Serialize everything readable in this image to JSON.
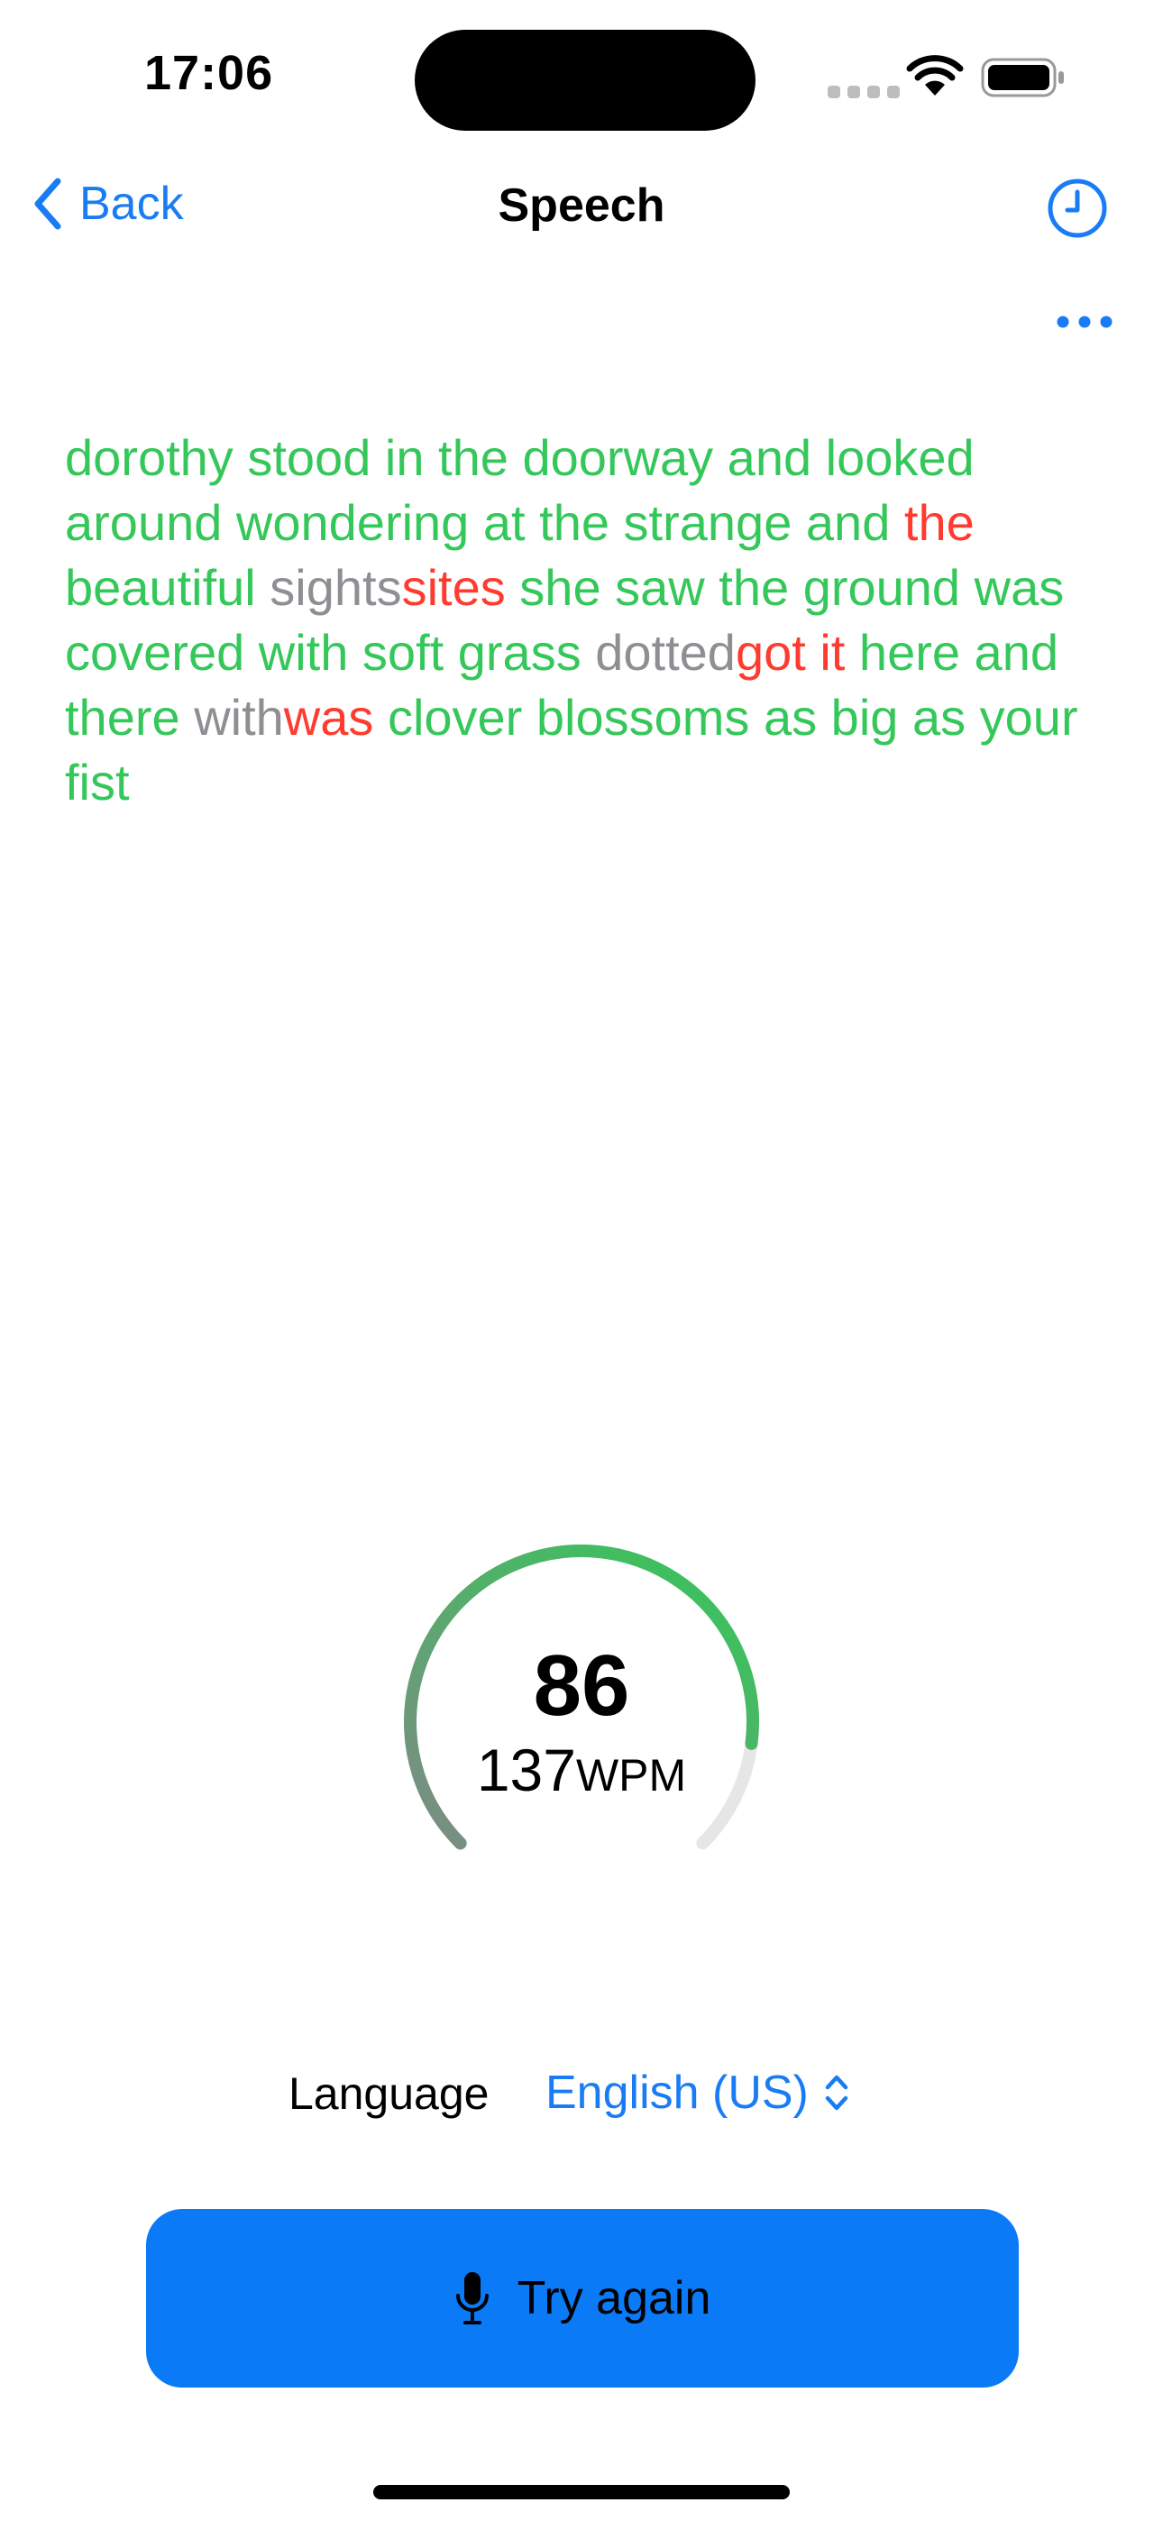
{
  "status_bar": {
    "time": "17:06"
  },
  "nav": {
    "back_label": "Back",
    "title": "Speech"
  },
  "transcript": [
    {
      "text": " dorothy stood in the doorway and looked around wondering at the strange and ",
      "status": "correct"
    },
    {
      "text": "the",
      "status": "wrong"
    },
    {
      "text": " beautiful ",
      "status": "correct"
    },
    {
      "text": "sights",
      "status": "missed"
    },
    {
      "text": "sites",
      "status": "wrong"
    },
    {
      "text": " she saw the ground was covered with soft grass ",
      "status": "correct"
    },
    {
      "text": "dotted",
      "status": "missed"
    },
    {
      "text": "got it",
      "status": "wrong"
    },
    {
      "text": " here and there ",
      "status": "correct"
    },
    {
      "text": "with",
      "status": "missed"
    },
    {
      "text": "was",
      "status": "wrong"
    },
    {
      "text": " clover blossoms as big as your fist",
      "status": "correct"
    }
  ],
  "result": {
    "score": "86",
    "score_value": 86,
    "wpm_value": "137",
    "wpm_unit": "WPM"
  },
  "language": {
    "label": "Language",
    "selected": "English (US)"
  },
  "action": {
    "label": "Try again"
  },
  "colors": {
    "accent": "#0a7af7",
    "correct": "#34c759",
    "wrong": "#ff3b30",
    "missed": "#8e8e93"
  },
  "icons": {
    "back": "chevron-left-icon",
    "history": "clock-icon",
    "more": "ellipsis-icon",
    "language": "chevron-up-down-icon",
    "mic": "microphone-icon"
  }
}
